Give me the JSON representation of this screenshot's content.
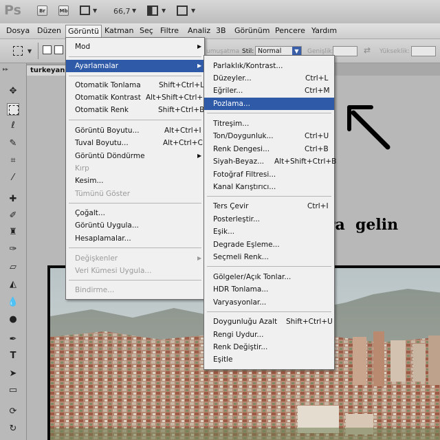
{
  "appbar": {
    "logo": "Ps",
    "buttons": [
      "Br",
      "Mb"
    ],
    "zoom": "66,7"
  },
  "menubar": [
    "Dosya",
    "Düzen",
    "Görüntü",
    "Katman",
    "Seç",
    "Filtre",
    "Analiz",
    "3B",
    "Görünüm",
    "Pencere",
    "Yardım"
  ],
  "options": {
    "partial": "umuşatma",
    "stil_label": "Stil:",
    "stil_value": "Normal",
    "genislik_label": "Genişlik:",
    "yukseklik_label": "Yükseklik:"
  },
  "document_tab": "turkeyank",
  "goruntu_menu": [
    {
      "label": "Mod",
      "submenu": true
    },
    {
      "label": "Ayarlamalar",
      "submenu": true,
      "highlighted": true
    },
    {
      "label": "Otomatik Tonlama",
      "shortcut": "Shift+Ctrl+L"
    },
    {
      "label": "Otomatik Kontrast",
      "shortcut": "Alt+Shift+Ctrl+L"
    },
    {
      "label": "Otomatik Renk",
      "shortcut": "Shift+Ctrl+B"
    },
    {
      "label": "Görüntü Boyutu...",
      "shortcut": "Alt+Ctrl+I"
    },
    {
      "label": "Tuval Boyutu...",
      "shortcut": "Alt+Ctrl+C"
    },
    {
      "label": "Görüntü Döndürme",
      "submenu": true
    },
    {
      "label": "Kırp",
      "disabled": true
    },
    {
      "label": "Kesim..."
    },
    {
      "label": "Tümünü Göster",
      "disabled": true
    },
    {
      "label": "Çoğalt..."
    },
    {
      "label": "Görüntü Uygula..."
    },
    {
      "label": "Hesaplamalar..."
    },
    {
      "label": "Değişkenler",
      "submenu": true,
      "disabled": true
    },
    {
      "label": "Veri Kümesi Uygula...",
      "disabled": true
    },
    {
      "label": "Bindirme...",
      "disabled": true
    }
  ],
  "ayarlamalar_menu": [
    {
      "label": "Parlaklık/Kontrast..."
    },
    {
      "label": "Düzeyler...",
      "shortcut": "Ctrl+L"
    },
    {
      "label": "Eğriler...",
      "shortcut": "Ctrl+M"
    },
    {
      "label": "Pozlama...",
      "highlighted": true
    },
    {
      "label": "Titreşim..."
    },
    {
      "label": "Ton/Doygunluk...",
      "shortcut": "Ctrl+U"
    },
    {
      "label": "Renk Dengesi...",
      "shortcut": "Ctrl+B"
    },
    {
      "label": "Siyah-Beyaz...",
      "shortcut": "Alt+Shift+Ctrl+B"
    },
    {
      "label": "Fotoğraf Filtresi..."
    },
    {
      "label": "Kanal Karıştırıcı..."
    },
    {
      "label": "Ters Çevir",
      "shortcut": "Ctrl+I"
    },
    {
      "label": "Posterleştir..."
    },
    {
      "label": "Eşik..."
    },
    {
      "label": "Degrade Eşleme..."
    },
    {
      "label": "Seçmeli Renk..."
    },
    {
      "label": "Gölgeler/Açık Tonlar..."
    },
    {
      "label": "HDR Tonlama..."
    },
    {
      "label": "Varyasyonlar..."
    },
    {
      "label": "Doygunluğu Azalt",
      "shortcut": "Shift+Ctrl+U"
    },
    {
      "label": "Rengi Uydur..."
    },
    {
      "label": "Renk Değiştir..."
    },
    {
      "label": "Eşitle"
    }
  ],
  "annotation": "Asamalara  gelin"
}
